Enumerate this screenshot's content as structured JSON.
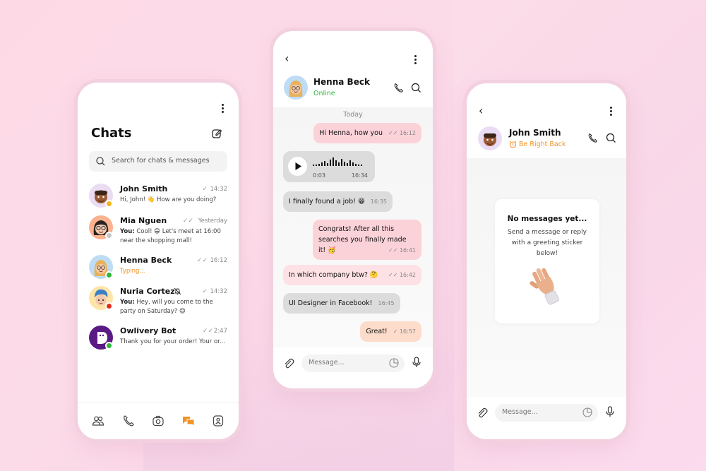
{
  "colors": {
    "accent": "#f39222",
    "online": "#2db83d",
    "away": "#f2b418",
    "busy": "#e02d1c",
    "offline": "#c8c8c8",
    "bubble_pink": "#fbd2d8",
    "bubble_grey": "#dcdcdc",
    "bubble_peach": "#fddccb"
  },
  "chats_screen": {
    "title": "Chats",
    "menu_icon": "more-vertical-icon",
    "compose_icon": "edit-icon",
    "search": {
      "placeholder": "Search for chats & messages",
      "icon": "search-icon"
    },
    "chats": [
      {
        "name": "John Smith",
        "time": "14:32",
        "check": "single",
        "preview_prefix": "",
        "preview": "Hi, John! 👋 How are you doing?",
        "status": "away"
      },
      {
        "name": "Mia Nguen",
        "time": "Yesterday",
        "check": "double",
        "preview_prefix": "You:",
        "preview": "Cool! 😁 Let's meet at 16:00 near the shopping mall!",
        "status": "offline"
      },
      {
        "name": "Henna Beck",
        "time": "16:12",
        "check": "double",
        "preview_prefix": "",
        "preview": "Typing...",
        "status": "online",
        "typing": true
      },
      {
        "name": "Nuria Cortez",
        "time": "14:32",
        "check": "single",
        "muted": true,
        "preview_prefix": "You:",
        "preview": "Hey, will you come to the party on Saturday? 😄",
        "status": "busy"
      },
      {
        "name": "Owlivery Bot",
        "time": "2:47",
        "check": "double",
        "preview_prefix": "",
        "preview": "Thank you for your order! Your or...",
        "status": "online"
      }
    ],
    "bottom_nav": [
      {
        "name": "contacts",
        "icon": "users-icon",
        "active": false
      },
      {
        "name": "calls",
        "icon": "phone-icon",
        "active": false
      },
      {
        "name": "camera",
        "icon": "camera-icon",
        "active": false
      },
      {
        "name": "chats",
        "icon": "chat-bubbles-icon",
        "active": true
      },
      {
        "name": "profile",
        "icon": "profile-icon",
        "active": false
      }
    ]
  },
  "conversation_screen": {
    "contact_name": "Henna Beck",
    "contact_status": "Online",
    "day_label": "Today",
    "messages": [
      {
        "direction": "out",
        "text": "Hi Henna, how you",
        "time": "16:12",
        "check": "double"
      },
      {
        "direction": "in",
        "type": "voice",
        "duration": "0:03",
        "time": "16:34"
      },
      {
        "direction": "in",
        "text": "I finally found a job! 😁",
        "time": "16:35"
      },
      {
        "direction": "out",
        "text_lines": [
          "Congrats! After all this",
          "searches you finally made",
          "it! 🥳"
        ],
        "time": "16:41",
        "check": "double"
      },
      {
        "direction": "out",
        "text": "In which company btw? 🤔",
        "time": "16:42",
        "check": "double"
      },
      {
        "direction": "in",
        "text": "UI Designer in Facebook!",
        "time": "16:45"
      },
      {
        "direction": "out",
        "text": "Great!",
        "time": "16:57",
        "check": "single"
      }
    ],
    "composer": {
      "placeholder": "Message..."
    }
  },
  "empty_screen": {
    "contact_name": "John Smith",
    "contact_status": "Be Right Back",
    "empty_title": "No messages yet...",
    "empty_text": "Send a message or reply with a greeting sticker below!",
    "sticker": "waving-hand-sticker",
    "composer": {
      "placeholder": "Message..."
    }
  }
}
